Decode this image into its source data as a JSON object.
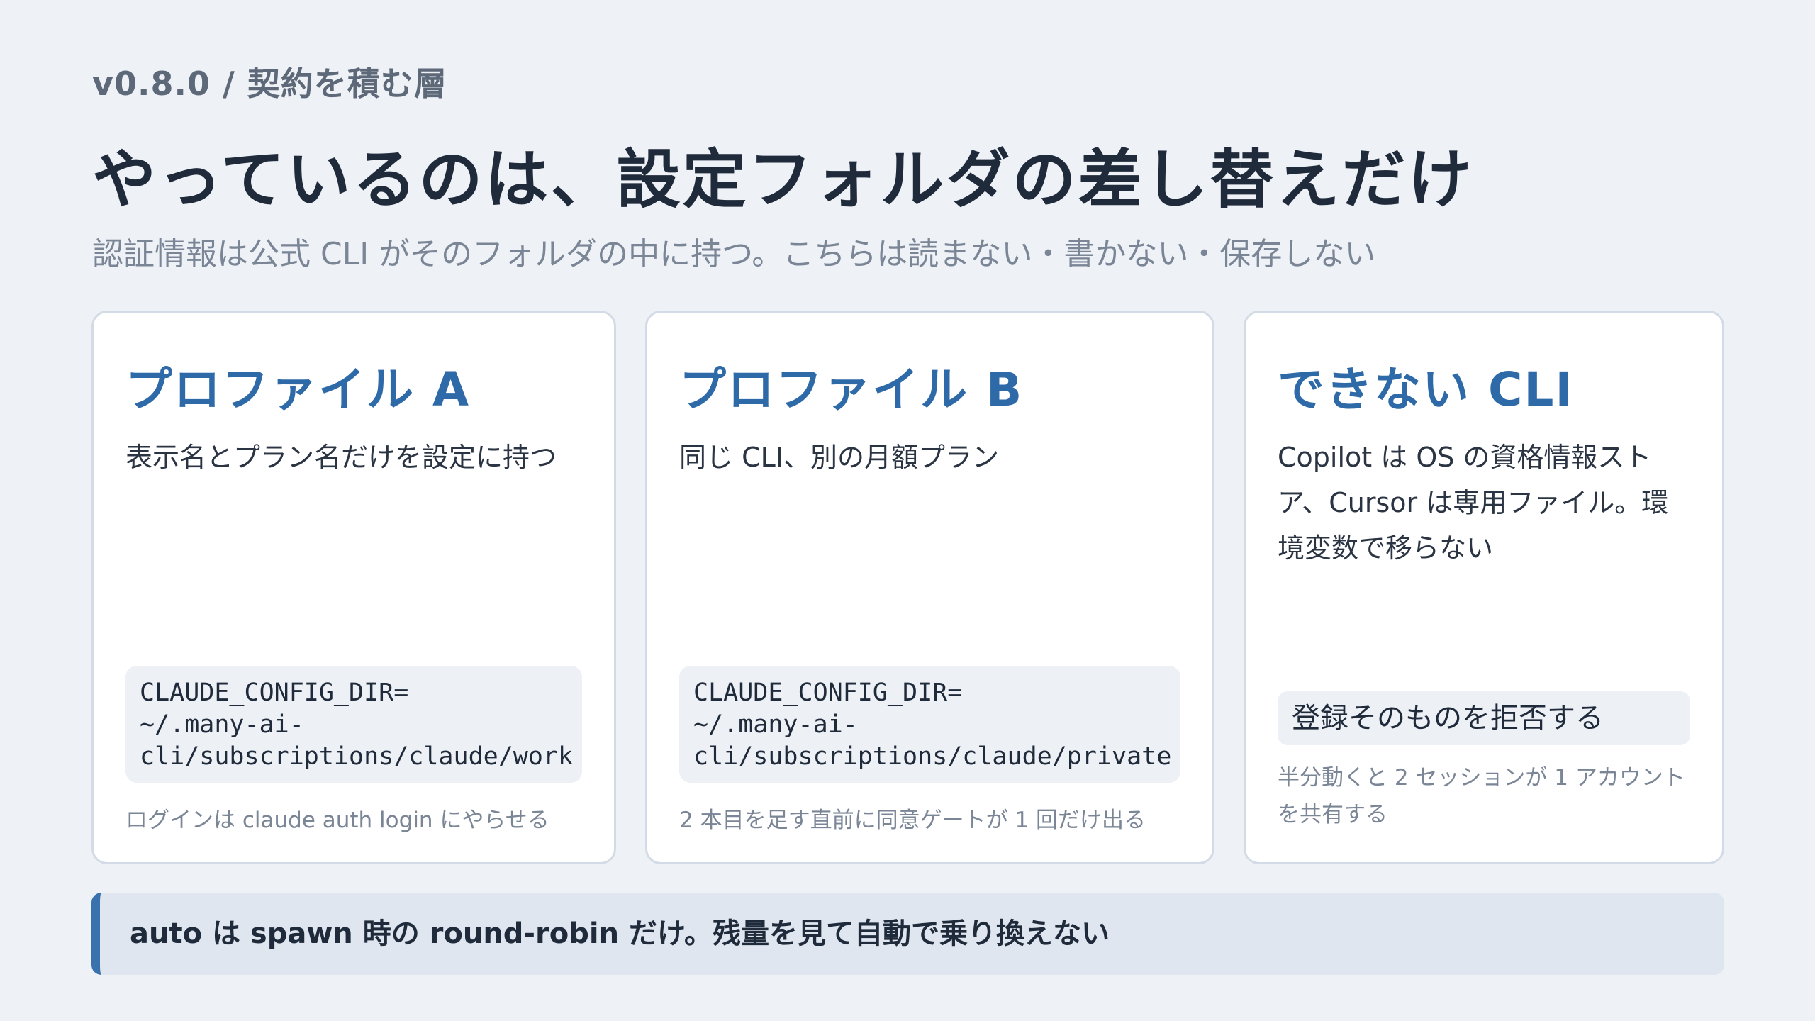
{
  "header": {
    "eyebrow": "v0.8.0 / 契約を積む層",
    "title": "やっているのは、設定フォルダの差し替えだけ",
    "subtitle": "認証情報は公式 CLI がそのフォルダの中に持つ。こちらは読まない・書かない・保存しない"
  },
  "cards": {
    "a": {
      "title": "プロファイル A",
      "description": "表示名とプラン名だけを設定に持つ",
      "code_lines": [
        "CLAUDE_CONFIG_DIR=",
        "~/.many-ai-",
        "cli/subscriptions/claude/work"
      ],
      "note": "ログインは claude auth login にやらせる"
    },
    "b": {
      "title": "プロファイル B",
      "description": "同じ CLI、別の月額プラン",
      "code_lines": [
        "CLAUDE_CONFIG_DIR=",
        "~/.many-ai-",
        "cli/subscriptions/claude/private"
      ],
      "note": "2 本目を足す直前に同意ゲートが 1 回だけ出る"
    },
    "c": {
      "title": "できない CLI",
      "description": "Copilot は OS の資格情報ストア、Cursor は専用ファイル。環境変数で移らない",
      "refuse": "登録そのものを拒否する",
      "note": "半分動くと 2 セッションが 1 アカウントを共有する"
    }
  },
  "banner": {
    "text": "auto は spawn 時の round-robin だけ。残量を見て自動で乗り換えない"
  },
  "colors": {
    "background": "#eef1f6",
    "accent": "#2f6aa8",
    "banner_bar": "#3a72ad",
    "card_border": "#d3dbe6"
  }
}
